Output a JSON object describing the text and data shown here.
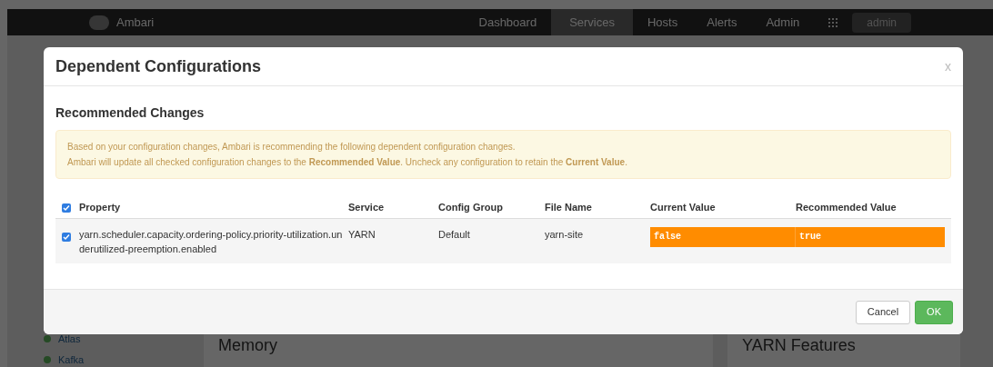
{
  "navbar": {
    "brand": "Ambari",
    "items": [
      {
        "label": "Dashboard",
        "selected": false
      },
      {
        "label": "Services",
        "selected": true
      },
      {
        "label": "Hosts",
        "selected": false
      },
      {
        "label": "Alerts",
        "selected": false
      },
      {
        "label": "Admin",
        "selected": false
      }
    ],
    "user": "admin"
  },
  "sidebar": {
    "items": [
      "Atlas",
      "Kafka"
    ]
  },
  "panels": [
    "Memory",
    "YARN Features"
  ],
  "dialog": {
    "title": "Dependent Configurations",
    "close": "x",
    "section": "Recommended Changes",
    "alert": [
      "Based on your configuration changes, Ambari is recommending the following dependent configuration changes.",
      "Ambari will update all checked configuration changes to the **Recommended Value**. Uncheck any configuration to retain the **Current Value**."
    ],
    "table": {
      "all_checked": true,
      "columns": [
        "Property",
        "Service",
        "Config Group",
        "File Name",
        "Current Value",
        "Recommended Value"
      ],
      "rows": [
        {
          "checked": true,
          "property": "yarn.scheduler.capacity.ordering-policy.priority-utilization.underutilized-preemption.enabled",
          "service": "YARN",
          "config_group": "Default",
          "file_name": "yarn-site",
          "current_value": "false",
          "recommended_value": "true"
        }
      ]
    },
    "buttons": [
      {
        "label": "Cancel",
        "kind": "default"
      },
      {
        "label": "OK",
        "kind": "primary"
      }
    ]
  }
}
